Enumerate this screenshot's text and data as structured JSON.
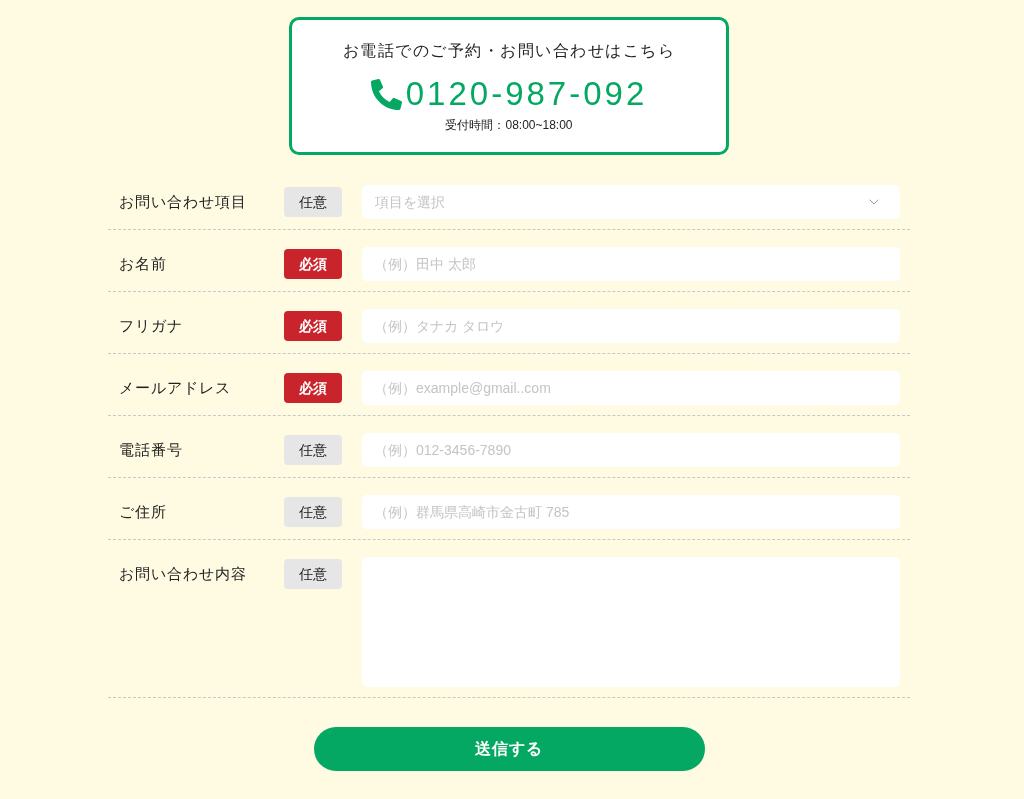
{
  "contact_box": {
    "heading": "お電話でのご予約・お問い合わせはこちら",
    "phone": "0120-987-092",
    "hours": "受付時間：08:00~18:00"
  },
  "fields": [
    {
      "label": "お問い合わせ項目",
      "badge": "任意",
      "required": false,
      "kind": "select",
      "placeholder": "項目を選択"
    },
    {
      "label": "お名前",
      "badge": "必須",
      "required": true,
      "kind": "text",
      "placeholder": "（例）田中 太郎"
    },
    {
      "label": "フリガナ",
      "badge": "必須",
      "required": true,
      "kind": "text",
      "placeholder": "（例）タナカ タロウ"
    },
    {
      "label": "メールアドレス",
      "badge": "必須",
      "required": true,
      "kind": "text",
      "placeholder": "（例）example@gmail..com"
    },
    {
      "label": "電話番号",
      "badge": "任意",
      "required": false,
      "kind": "text",
      "placeholder": "（例）012-3456-7890"
    },
    {
      "label": "ご住所",
      "badge": "任意",
      "required": false,
      "kind": "text",
      "placeholder": "（例）群馬県高崎市金古町 785"
    },
    {
      "label": "お問い合わせ内容",
      "badge": "任意",
      "required": false,
      "kind": "textarea"
    }
  ],
  "submit_button": "送信する"
}
